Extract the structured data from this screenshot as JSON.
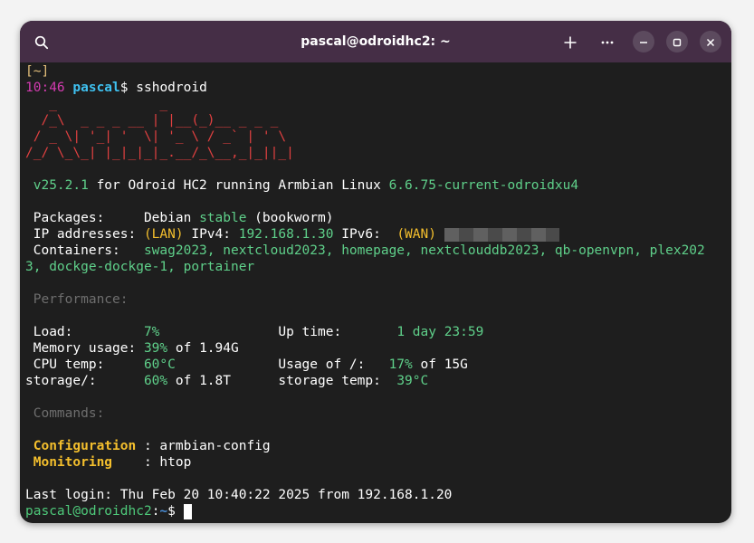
{
  "window": {
    "title": "pascal@odroidhc2: ~",
    "buttons": {
      "search": "search",
      "new_tab": "add",
      "menu": "menu",
      "minimize": "minimize",
      "maximize": "maximize",
      "close": "close"
    }
  },
  "terminal": {
    "cwd_line": "[~]",
    "prompt1": {
      "time": "10:46",
      "user": "pascal",
      "symbol": "$ ",
      "command": "sshodroid"
    },
    "banner": [
      "   _             _    ",
      "  /_\\  _ _ _ __ | |__(_)__ _ _ _",
      " / _ \\| '_| '  \\| '_ \\ / _` | ' \\",
      "/_/ \\_\\_| |_|_|_|_.__/_\\__,_|_||_|"
    ],
    "version_line": {
      "version": "v25.2.1",
      "middle": " for Odroid HC2 running Armbian Linux ",
      "kernel": "6.6.75-current-odroidxu4"
    },
    "packages": {
      "label": " Packages:     Debian ",
      "stable": "stable",
      "rest": " (bookworm)"
    },
    "ip": {
      "label": " IP addresses: ",
      "lan": "(LAN)",
      "ipv4_label": " IPv4: ",
      "ipv4": "192.168.1.30",
      "ipv6_label": " IPv6:  ",
      "wan": "(WAN)"
    },
    "containers": {
      "label": " Containers:   ",
      "line1": "swag2023, nextcloud2023, homepage, nextclouddb2023, qb-openvpn, plex202",
      "line2": "3, dockge-dockge-1, portainer"
    },
    "performance_header": " Performance:",
    "load": {
      "label": " Load:         ",
      "value": "7%",
      "gap": "               Up time:       ",
      "uptime": "1 day 23:59"
    },
    "memory": {
      "label": " Memory usage: ",
      "value": "39%",
      "rest": " of 1.94G"
    },
    "cpu": {
      "label": " CPU temp:     ",
      "value": "60°C",
      "gap": "             Usage of /:   ",
      "usage": "17%",
      "rest": " of 15G"
    },
    "storage": {
      "label": "storage/:      ",
      "value": "60%",
      "rest": " of 1.8T      ",
      "temp_label": "storage temp:  ",
      "temp": "39°C"
    },
    "commands_header": " Commands:",
    "config": {
      "label": "Configuration",
      "rest": " : armbian-config"
    },
    "monitoring": {
      "label": "Monitoring",
      "rest": "    : htop"
    },
    "last_login": "Last login: Thu Feb 20 10:40:22 2025 from 192.168.1.20",
    "prompt2": {
      "userhost": "pascal@odroidhc2",
      "colon": ":",
      "path": "~",
      "symbol": "$ "
    }
  }
}
